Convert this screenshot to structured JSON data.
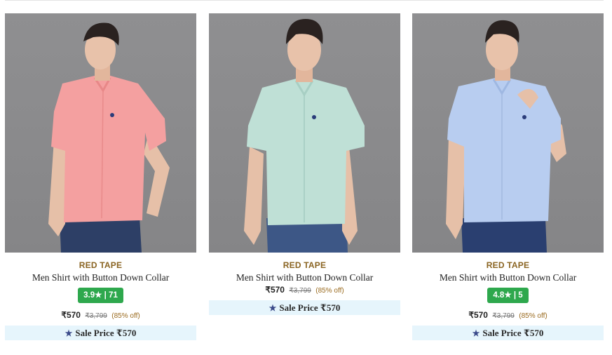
{
  "products": [
    {
      "brand": "RED TAPE",
      "title": "Men Shirt with Button Down Collar",
      "rating": "3.9★ | 71",
      "price": "₹570",
      "mrp": "₹3,799",
      "discount": "(85% off)",
      "sale_label": "Sale Price ₹570",
      "shirt_color": "#f4a0a0"
    },
    {
      "brand": "RED TAPE",
      "title": "Men Shirt with Button Down Collar",
      "rating": "",
      "price": "₹570",
      "mrp": "₹3,799",
      "discount": "(85% off)",
      "sale_label": "Sale Price ₹570",
      "shirt_color": "#bfe0d6"
    },
    {
      "brand": "RED TAPE",
      "title": "Men Shirt with Button Down Collar",
      "rating": "4.8★ | 5",
      "price": "₹570",
      "mrp": "₹3,799",
      "discount": "(85% off)",
      "sale_label": "Sale Price ₹570",
      "shirt_color": "#b8cdf0"
    }
  ],
  "colors": {
    "rating_badge": "#2ea84d",
    "brand_text": "#8a6422",
    "sale_banner": "#e6f5fc",
    "star_icon": "#3a4a8a"
  },
  "icons": {
    "sale": "star-icon"
  }
}
